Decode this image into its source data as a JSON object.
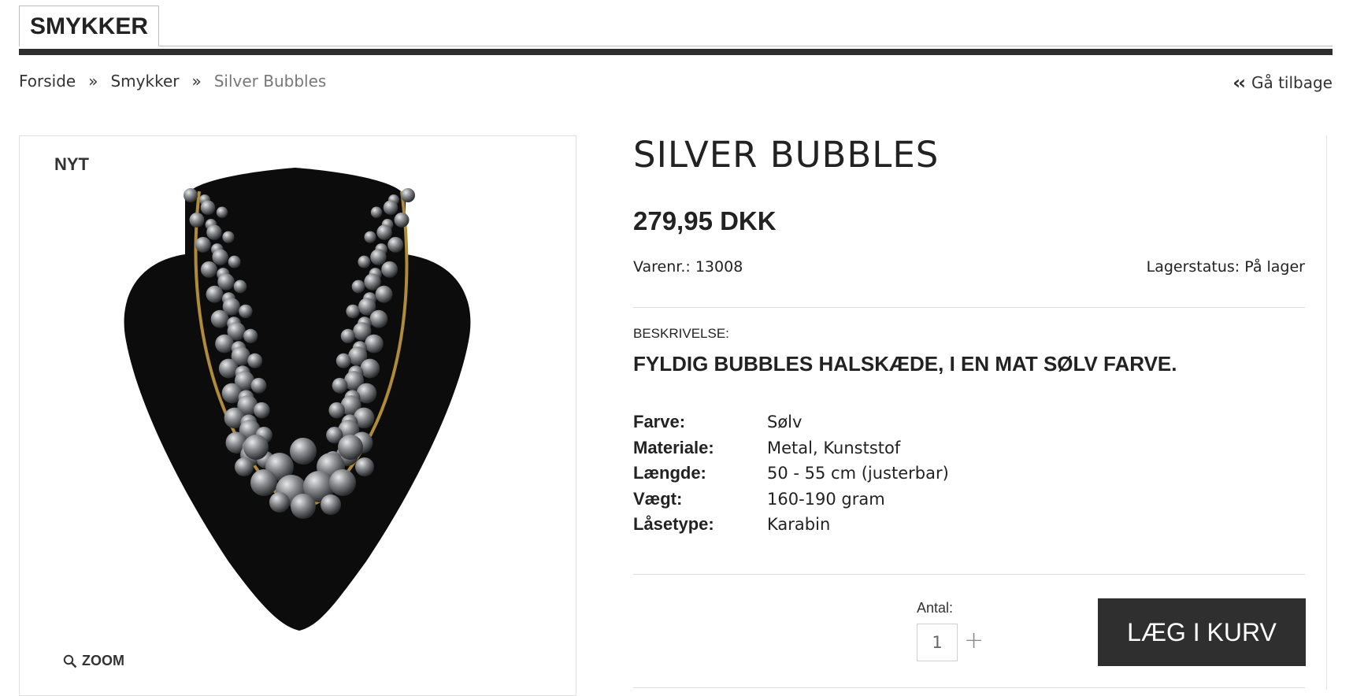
{
  "tab": {
    "label": "SMYKKER"
  },
  "breadcrumb": {
    "items": [
      "Forside",
      "Smykker",
      "Silver Bubbles"
    ],
    "separator": "»"
  },
  "back": {
    "icon": "double-chevron-left-icon",
    "label": "Gå tilbage"
  },
  "image": {
    "badge": "NYT",
    "zoom_label": "ZOOM",
    "zoom_icon": "search-icon"
  },
  "product": {
    "title": "SILVER BUBBLES",
    "price": "279,95 DKK",
    "sku": "Varenr.: 13008",
    "stock": "Lagerstatus: På lager",
    "description_label": "BESKRIVELSE:",
    "description": "FYLDIG BUBBLES HALSKÆDE, I EN MAT SØLV FARVE.",
    "specs": [
      {
        "key": "Farve:",
        "value": "Sølv"
      },
      {
        "key": "Materiale:",
        "value": "Metal, Kunststof"
      },
      {
        "key": "Længde:",
        "value": "50 - 55 cm (justerbar)"
      },
      {
        "key": "Vægt:",
        "value": "160-190 gram"
      },
      {
        "key": "Låsetype:",
        "value": "Karabin"
      }
    ]
  },
  "cart": {
    "quantity_label": "Antal:",
    "quantity_value": "1",
    "plus_symbol": "+",
    "button_label": "LÆG I KURV"
  },
  "colors": {
    "dark": "#2f2f2f",
    "border": "#dcdcdc"
  }
}
